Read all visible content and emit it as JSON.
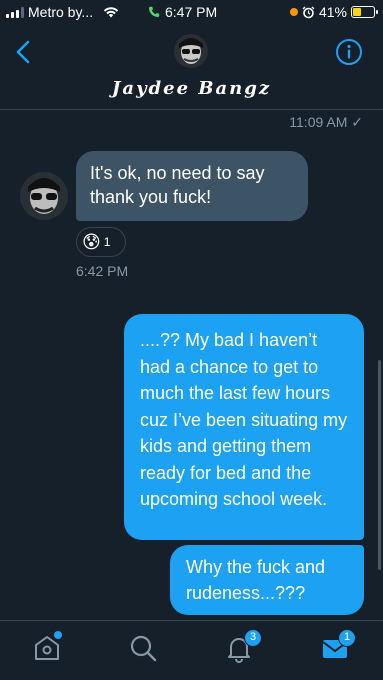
{
  "status_bar": {
    "carrier": "Metro by...",
    "time": "6:47 PM",
    "battery": "41%",
    "battery_level": 0.41,
    "icons": [
      "signal-icon",
      "wifi-icon",
      "phone-icon",
      "alarm-icon",
      "battery-icon"
    ]
  },
  "header": {
    "name": "Jaydee Bangz",
    "icons": [
      "back-chevron-icon",
      "info-icon"
    ]
  },
  "conversation": {
    "top_timestamp": "11:09 AM ✓",
    "incoming": {
      "text": "It's ok, no need to say thank you fuck!",
      "reaction_emoji": "😰",
      "reaction_count": "1",
      "time": "6:42 PM"
    },
    "outgoing": [
      {
        "text": "....?? My bad I haven’t had a chance to get to much the last few hours cuz I’ve been situating my kids and getting them ready for bed and the upcoming school week."
      },
      {
        "text": "Why the fuck and rudeness...???"
      }
    ]
  },
  "tab_bar": {
    "tabs": [
      {
        "name": "home",
        "icon": "home-icon"
      },
      {
        "name": "search",
        "icon": "search-icon"
      },
      {
        "name": "notifications",
        "icon": "bell-icon",
        "badge": "3"
      },
      {
        "name": "messages",
        "icon": "mail-icon",
        "badge": "1"
      }
    ]
  },
  "colors": {
    "background": "#15202b",
    "incoming_bubble": "#3d5466",
    "outgoing_bubble": "#1da1f2",
    "accent": "#1da1f2",
    "secondary_text": "#8899a6"
  }
}
